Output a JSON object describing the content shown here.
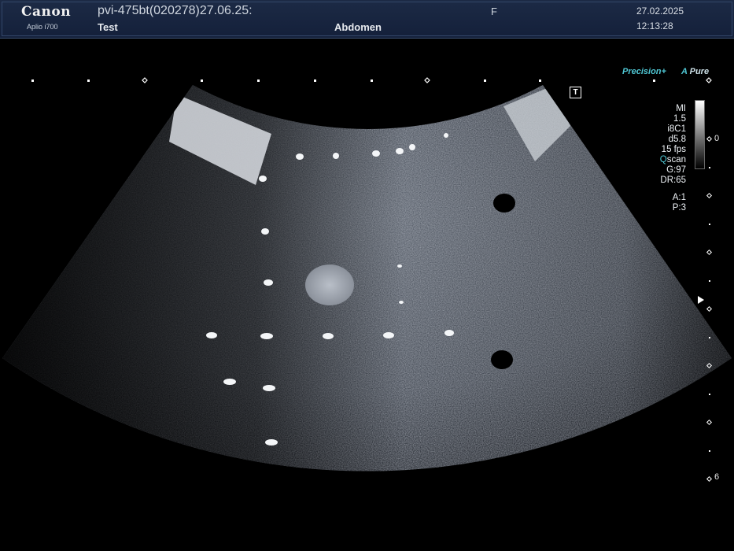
{
  "header": {
    "brand": "Canon",
    "model": "Aplio i700",
    "patient_id": "pvi-475bt(020278)27.06.25:",
    "patient_name": "Test",
    "sex": "F",
    "exam": "Abdomen",
    "date": "27.02.2025",
    "time": "12:13:28"
  },
  "overlays": {
    "precision": "Precision+",
    "pure_prefix": "A",
    "pure": "Pure",
    "t_marker": "T"
  },
  "params": {
    "mi_label": "MI",
    "mi_value": "1.5",
    "probe": "i8C1",
    "depth": "d5.8",
    "fps": "15 fps",
    "qscan_prefix": "Q",
    "qscan": "scan",
    "gain": "G:97",
    "dr": "DR:65",
    "a": "A:1",
    "p": "P:3"
  },
  "scale": {
    "gray_value": "0",
    "depth_value": "6"
  }
}
